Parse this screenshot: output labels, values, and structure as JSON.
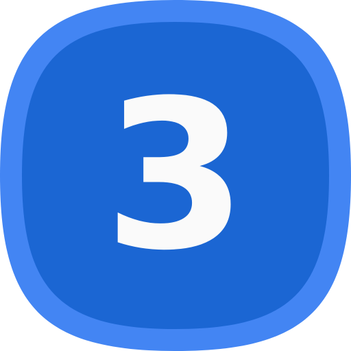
{
  "icon": {
    "name": "number-3-badge-icon",
    "number": "3",
    "colors": {
      "outer": "#4385f3",
      "inner": "#1b66d3",
      "digit": "#fafafa"
    }
  }
}
